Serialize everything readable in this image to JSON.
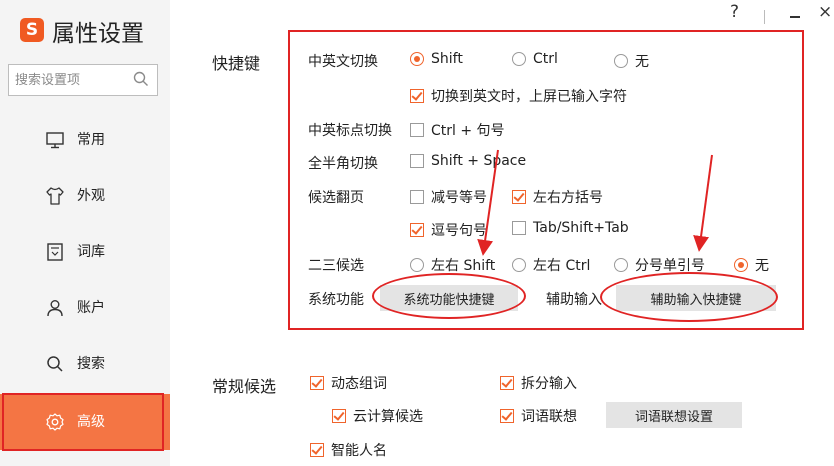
{
  "app": {
    "title": "属性设置",
    "logo_glyph": "S"
  },
  "window_controls": {
    "help": "?",
    "close": "×"
  },
  "sidebar": {
    "search_placeholder": "搜索设置项",
    "items": [
      {
        "label": "常用",
        "icon": "monitor-icon"
      },
      {
        "label": "外观",
        "icon": "shirt-icon"
      },
      {
        "label": "词库",
        "icon": "dictionary-icon"
      },
      {
        "label": "账户",
        "icon": "user-icon"
      },
      {
        "label": "搜索",
        "icon": "search-icon"
      },
      {
        "label": "高级",
        "icon": "gear-icon",
        "active": true
      }
    ]
  },
  "shortcuts": {
    "section_title": "快捷键",
    "cn_en_switch": {
      "label": "中英文切换",
      "options": [
        "Shift",
        "Ctrl",
        "无"
      ],
      "selected": "Shift",
      "upscreen_label": "切换到英文时，上屏已输入字符",
      "upscreen_checked": true
    },
    "punct_switch": {
      "label": "中英标点切换",
      "option": "Ctrl + 句号",
      "checked": false
    },
    "width_switch": {
      "label": "全半角切换",
      "option": "Shift + Space",
      "checked": false
    },
    "paging": {
      "label": "候选翻页",
      "options": [
        {
          "label": "减号等号",
          "checked": false
        },
        {
          "label": "左右方括号",
          "checked": true
        },
        {
          "label": "逗号句号",
          "checked": true
        },
        {
          "label": "Tab/Shift+Tab",
          "checked": false
        }
      ]
    },
    "second_third": {
      "label": "二三候选",
      "options": [
        "左右 Shift",
        "左右 Ctrl",
        "分号单引号",
        "无"
      ],
      "selected": "无"
    },
    "system_func": {
      "label": "系统功能",
      "button": "系统功能快捷键"
    },
    "aux_input": {
      "label": "辅助输入",
      "button": "辅助输入快捷键"
    }
  },
  "general": {
    "section_title": "常规候选",
    "options": [
      {
        "label": "动态组词",
        "checked": true
      },
      {
        "label": "拆分输入",
        "checked": true
      },
      {
        "label": "云计算候选",
        "checked": true
      },
      {
        "label": "词语联想",
        "checked": true
      },
      {
        "label": "智能人名",
        "checked": true
      }
    ],
    "assoc_button": "词语联想设置"
  },
  "colors": {
    "accent": "#f0642c",
    "sidebar_active": "#f47544",
    "annotation": "#e02424"
  }
}
